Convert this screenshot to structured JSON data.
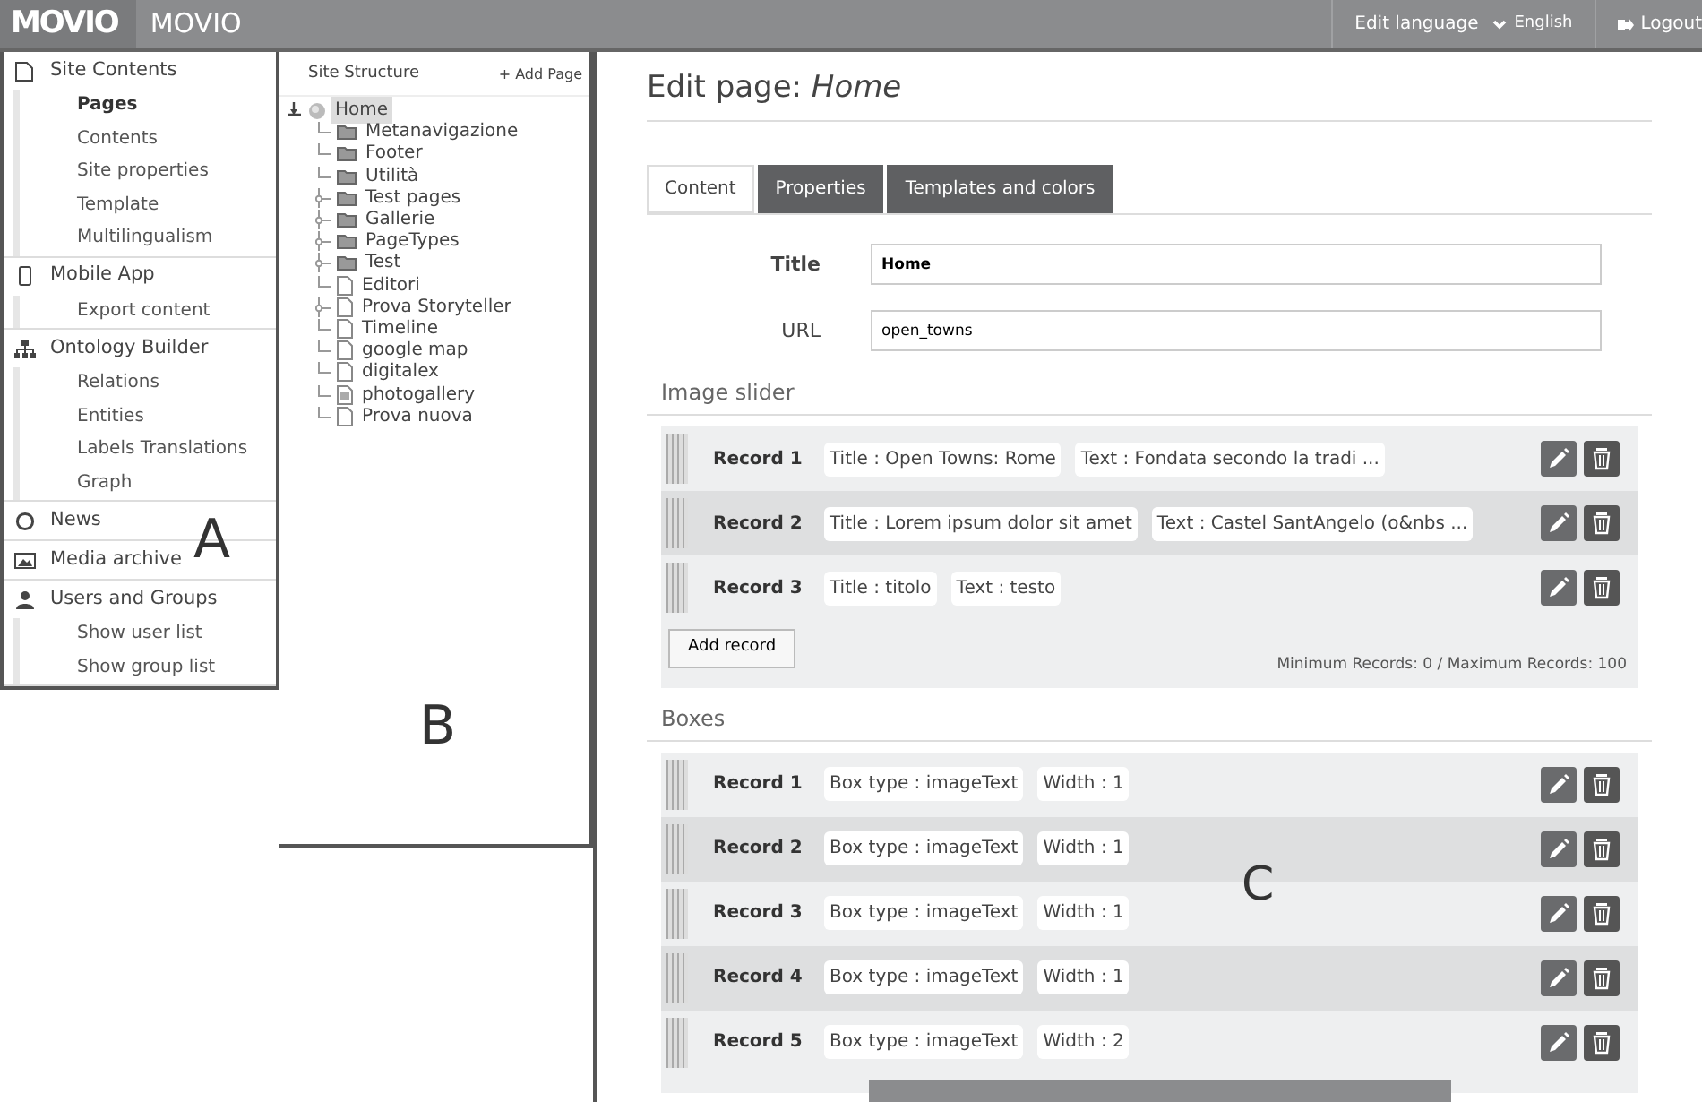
{
  "topbar": {
    "logo": "MOVIO",
    "app_name": "MOVIO",
    "language_label": "Edit language",
    "language": "English",
    "logout": "Logout"
  },
  "sidebar": {
    "annotation": "A",
    "groups": [
      {
        "kind": "page",
        "title": "Site Contents",
        "items": [
          {
            "label": "Pages",
            "selected": true
          },
          {
            "label": "Contents",
            "selected": false
          },
          {
            "label": "Site properties",
            "selected": false
          },
          {
            "label": "Template",
            "selected": false
          },
          {
            "label": "Multilingualism",
            "selected": false
          }
        ]
      },
      {
        "kind": "phone",
        "title": "Mobile App",
        "items": [
          {
            "label": "Export content",
            "selected": false
          }
        ]
      },
      {
        "kind": "sitemap",
        "title": "Ontology Builder",
        "items": [
          {
            "label": "Relations",
            "selected": false
          },
          {
            "label": "Entities",
            "selected": false
          },
          {
            "label": "Labels Translations",
            "selected": false
          },
          {
            "label": "Graph",
            "selected": false
          }
        ]
      },
      {
        "kind": "circle",
        "title": "News"
      },
      {
        "kind": "image",
        "title": "Media archive"
      },
      {
        "kind": "user",
        "title": "Users and Groups",
        "items": [
          {
            "label": "Show user list",
            "selected": false
          },
          {
            "label": "Show group list",
            "selected": false
          }
        ]
      }
    ]
  },
  "site_structure": {
    "title": "Site Structure",
    "add_page": "+ Add Page",
    "annotation": "B",
    "tree": [
      {
        "label": "Home",
        "kind": "home",
        "selected": true,
        "expanded": true,
        "children": [
          {
            "label": "Metanavigazione",
            "kind": "folder",
            "expandable": false
          },
          {
            "label": "Footer",
            "kind": "folder",
            "expandable": false
          },
          {
            "label": "Utilità",
            "kind": "folder",
            "expandable": false
          },
          {
            "label": "Test pages",
            "kind": "folder",
            "expandable": true
          },
          {
            "label": "Gallerie",
            "kind": "folder",
            "expandable": true
          },
          {
            "label": "PageTypes",
            "kind": "folder",
            "expandable": true
          },
          {
            "label": "Test",
            "kind": "folder",
            "expandable": true
          },
          {
            "label": "Editori",
            "kind": "page",
            "expandable": false
          },
          {
            "label": "Prova Storyteller",
            "kind": "page",
            "expandable": true
          },
          {
            "label": "Timeline",
            "kind": "page",
            "expandable": false
          },
          {
            "label": "google map",
            "kind": "page",
            "expandable": false
          },
          {
            "label": "digitalex",
            "kind": "page",
            "expandable": false
          },
          {
            "label": "photogallery",
            "kind": "gallery",
            "expandable": false
          },
          {
            "label": "Prova nuova",
            "kind": "page",
            "expandable": false
          }
        ]
      }
    ]
  },
  "editor": {
    "heading": "Edit page: *Home*",
    "annotation": "C",
    "tabs": [
      {
        "label": "Content",
        "selected": true
      },
      {
        "label": "Properties",
        "selected": false
      },
      {
        "label": "Templates and colors",
        "selected": false
      }
    ],
    "fields": [
      {
        "label": "Title",
        "value": "Home",
        "bold": true
      },
      {
        "label": "URL",
        "value": "open_towns",
        "bold": false
      }
    ],
    "sections": [
      {
        "title": "Image slider",
        "records": [
          {
            "label": "Record 1",
            "tags": [
              "Title : Open Towns: Rome",
              "Text :  Fondata secondo la tradi ..."
            ]
          },
          {
            "label": "Record 2",
            "tags": [
              "Title : Lorem ipsum dolor sit amet",
              "Text : Castel SantAngelo (o&nbs ..."
            ]
          },
          {
            "label": "Record 3",
            "tags": [
              "Title : titolo",
              "Text : testo"
            ]
          }
        ],
        "add_button": "Add record",
        "limits": "Minimum Records: 0 / Maximum Records: 100"
      },
      {
        "title": "Boxes",
        "records": [
          {
            "label": "Record 1",
            "tags": [
              "Box type : imageText",
              "Width : 1"
            ]
          },
          {
            "label": "Record 2",
            "tags": [
              "Box type : imageText",
              "Width : 1"
            ]
          },
          {
            "label": "Record 3",
            "tags": [
              "Box type : imageText",
              "Width : 1"
            ]
          },
          {
            "label": "Record 4",
            "tags": [
              "Box type : imageText",
              "Width : 1"
            ]
          },
          {
            "label": "Record 5",
            "tags": [
              "Box type : imageText",
              "Width : 2"
            ]
          }
        ]
      }
    ]
  }
}
